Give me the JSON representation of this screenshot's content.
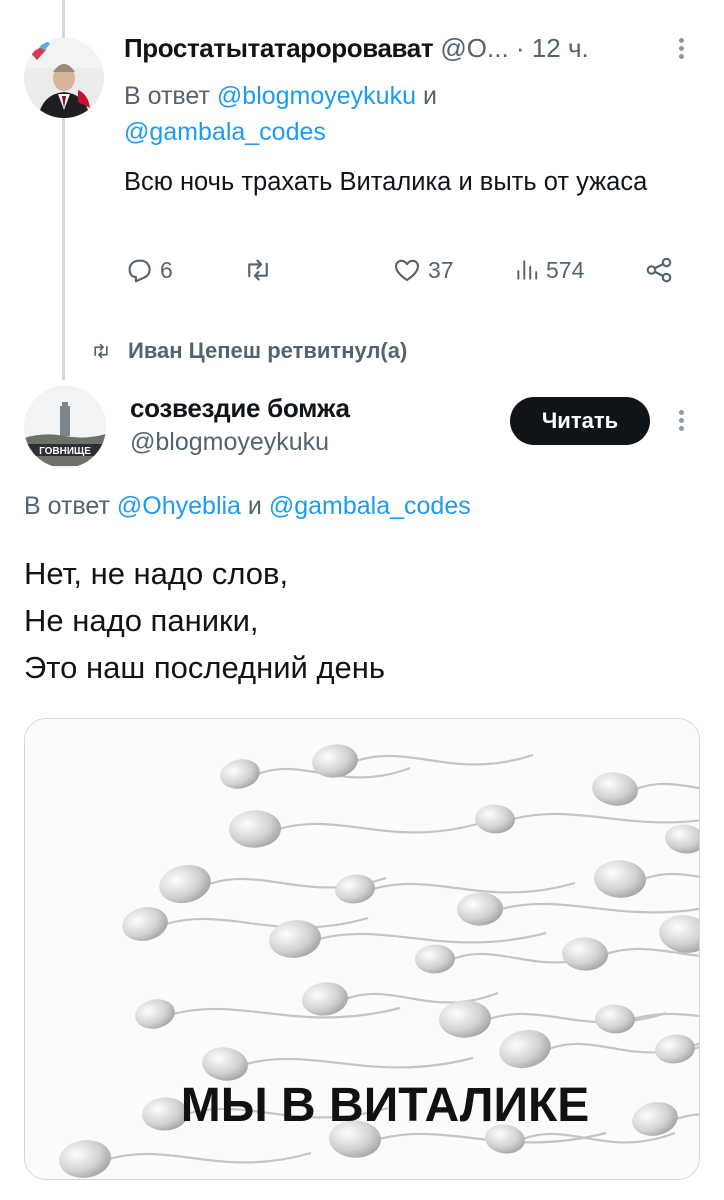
{
  "reply_tweet": {
    "author_name": "Простатытатаророватель",
    "author_name_display": "Простатытатарорoвават",
    "handle": "@О...",
    "time": "· 12 ч.",
    "reply_prefix": "В ответ ",
    "mention1": "@blogmoyeykuku",
    "reply_joiner": " и",
    "mention2": "@gambala_codes",
    "text": "Всю ночь трахать Виталика и выть от ужаса",
    "stats": {
      "replies": "6",
      "retweets": "",
      "likes": "37",
      "views": "574"
    }
  },
  "retweet_header": {
    "text": "Иван Цепеш ретвитнул(а)"
  },
  "main_tweet": {
    "author_name": "созвездие бомжа",
    "handle": "@blogmoyeykuku",
    "follow_label": "Читать",
    "avatar_caption": "ГОВНИЩЕ",
    "reply_prefix": "В ответ ",
    "mention1": "@Ohyeblia",
    "reply_joiner": " и ",
    "mention2": "@gambala_codes",
    "text_lines": [
      "Нет, не надо слов,",
      "Не надо паники,",
      "Это наш последний день"
    ],
    "media_caption": "МЫ В ВИТАЛИКЕ"
  },
  "colors": {
    "text": "#0f1419",
    "secondary": "#536471",
    "link": "#1d9bf0",
    "button_bg": "#0f1419",
    "border": "#cfd9de"
  }
}
